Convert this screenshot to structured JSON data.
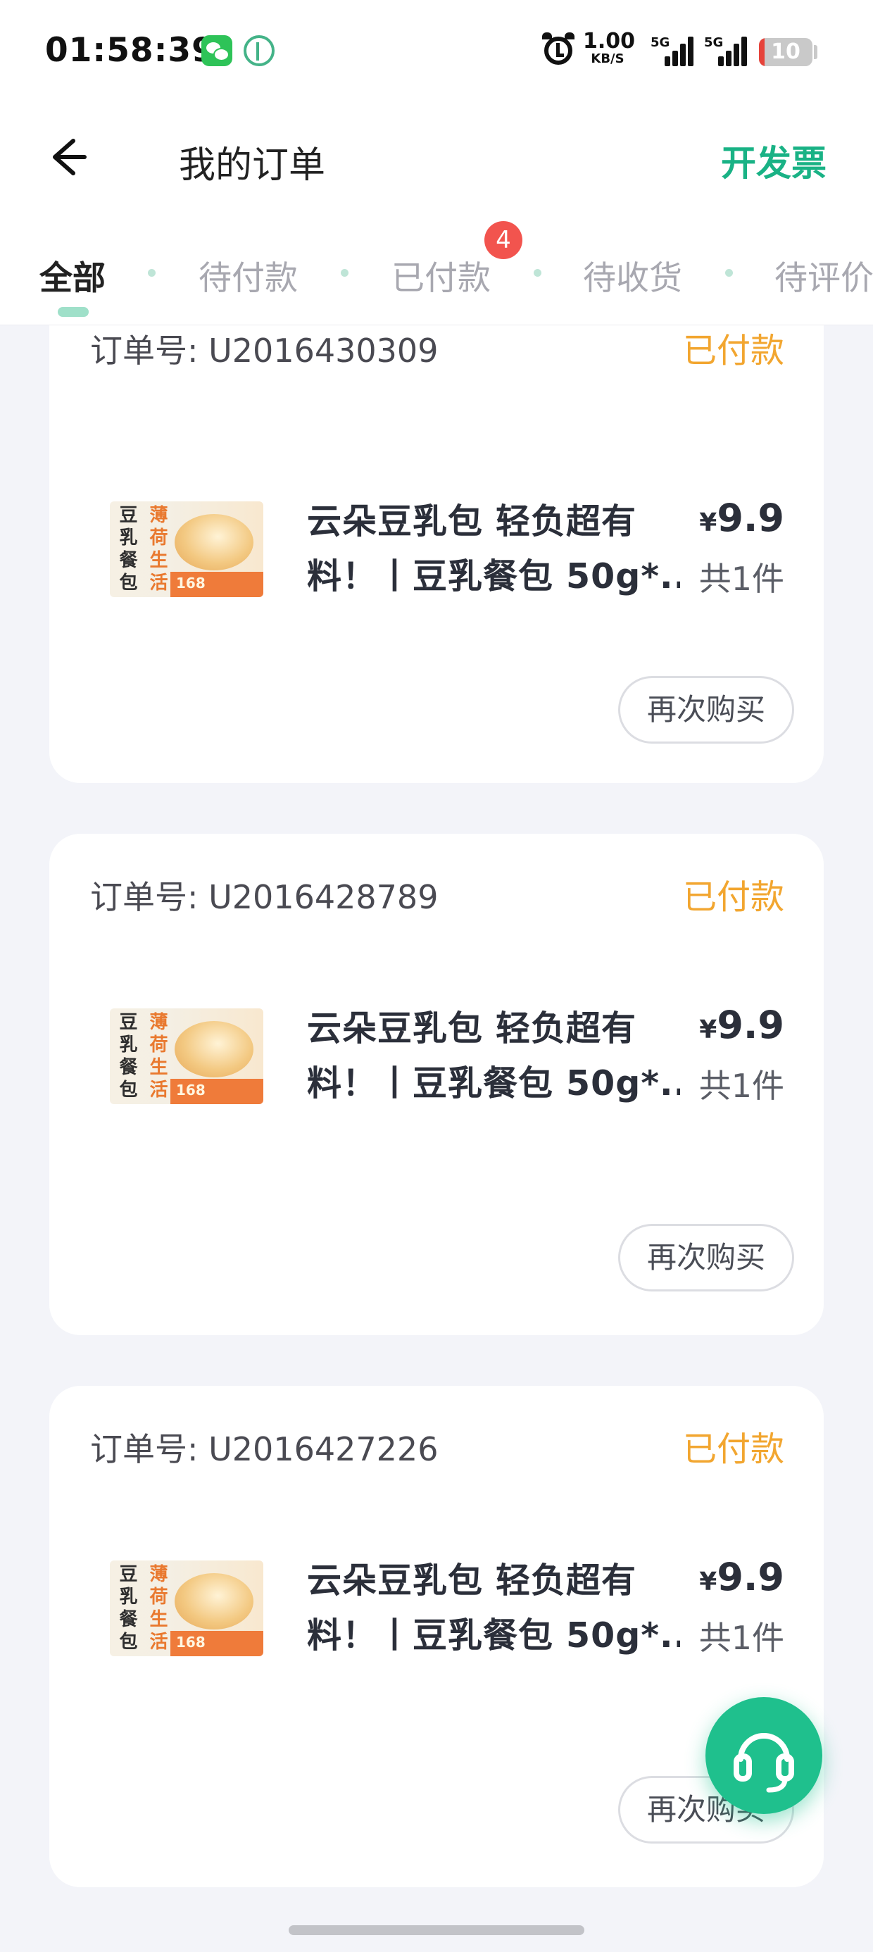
{
  "status_bar": {
    "time": "01:58:39",
    "net_speed_value": "1.00",
    "net_speed_unit": "KB/S",
    "sim1_label": "5G",
    "sim2_label": "5G",
    "battery": "10",
    "battery_level": 0.1
  },
  "header": {
    "title": "我的订单",
    "invoice_link": "开发票"
  },
  "tabs": [
    {
      "label": "全部",
      "active": true
    },
    {
      "label": "待付款",
      "active": false
    },
    {
      "label": "已付款",
      "active": false,
      "badge": "4"
    },
    {
      "label": "待收货",
      "active": false
    },
    {
      "label": "待评价",
      "active": false
    }
  ],
  "orders": [
    {
      "order_no": "订单号: U2016430309",
      "status": "已付款",
      "product_name_line1": "云朵豆乳包 轻负超有",
      "product_name_line2": "料！丨豆乳餐包 50g*...",
      "currency": "¥",
      "price": "9.9",
      "quantity": "共1件",
      "rebuy_label": "再次购买",
      "thumb": {
        "col1": [
          "豆",
          "乳",
          "餐",
          "包"
        ],
        "col2": [
          "薄",
          "荷",
          "生",
          "活"
        ],
        "tag": "168"
      }
    },
    {
      "order_no": "订单号: U2016428789",
      "status": "已付款",
      "product_name_line1": "云朵豆乳包 轻负超有",
      "product_name_line2": "料！丨豆乳餐包 50g*...",
      "currency": "¥",
      "price": "9.9",
      "quantity": "共1件",
      "rebuy_label": "再次购买",
      "thumb": {
        "col1": [
          "豆",
          "乳",
          "餐",
          "包"
        ],
        "col2": [
          "薄",
          "荷",
          "生",
          "活"
        ],
        "tag": "168"
      }
    },
    {
      "order_no": "订单号: U2016427226",
      "status": "已付款",
      "product_name_line1": "云朵豆乳包 轻负超有",
      "product_name_line2": "料！丨豆乳餐包 50g*...",
      "currency": "¥",
      "price": "9.9",
      "quantity": "共1件",
      "rebuy_label": "再次购买",
      "thumb": {
        "col1": [
          "豆",
          "乳",
          "餐",
          "包"
        ],
        "col2": [
          "薄",
          "荷",
          "生",
          "活"
        ],
        "tag": "168"
      }
    }
  ],
  "colors": {
    "accent_green": "#19b285",
    "status_orange": "#f2a630",
    "badge_red": "#f2544e",
    "page_bg": "#f3f4f9"
  },
  "icons": {
    "back": "arrow-left-icon",
    "support": "headset-icon",
    "alarm": "alarm-clock-icon"
  }
}
